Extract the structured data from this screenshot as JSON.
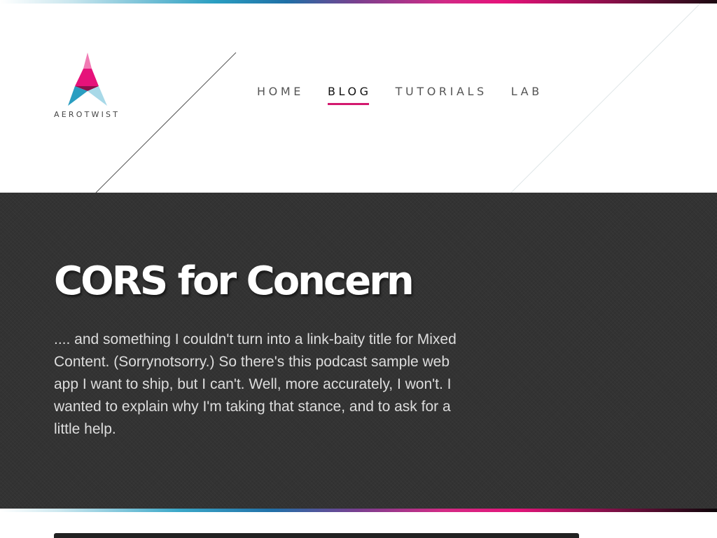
{
  "brand": {
    "logo_text": "AEROTWIST",
    "colors": {
      "accent": "#d3196e",
      "pink": "#e6127a",
      "blue": "#2a9ec1",
      "dark": "#333333"
    }
  },
  "nav": {
    "items": [
      {
        "label": "HOME",
        "active": false
      },
      {
        "label": "BLOG",
        "active": true
      },
      {
        "label": "TUTORIALS",
        "active": false
      },
      {
        "label": "LAB",
        "active": false
      }
    ]
  },
  "hero": {
    "title": "CORS for Concern",
    "intro": ".... and something I couldn't turn into a link-baity title for Mixed Content. (Sorrynotsorry.) So there's this podcast sample web app I want to ship, but I can't. Well, more accurately, I won't. I wanted to explain why I'm taking that stance, and to ask for a little help."
  }
}
